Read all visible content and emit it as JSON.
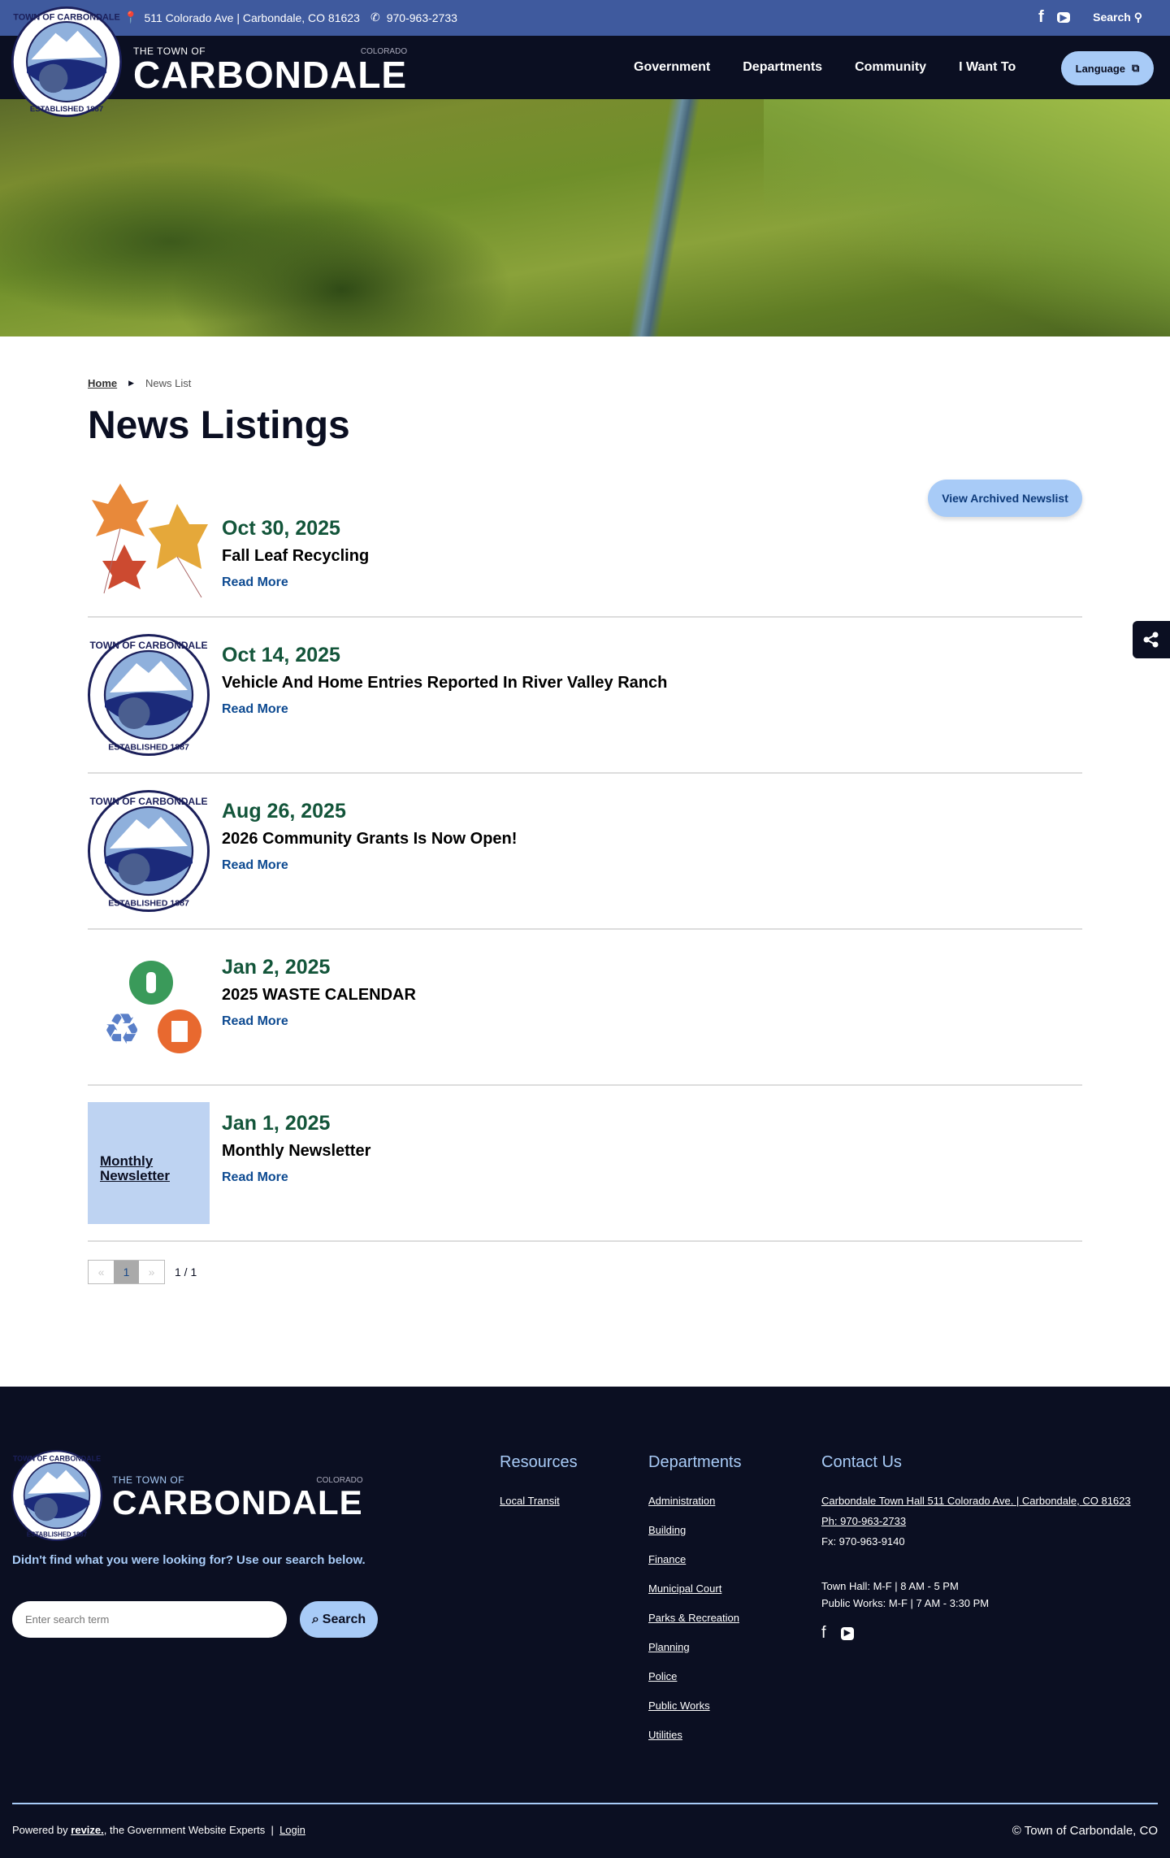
{
  "topbar": {
    "address": "511 Colorado Ave | Carbondale, CO 81623",
    "phone": "970-963-2733",
    "search_label": "Search"
  },
  "brand": {
    "pre": "THE TOWN OF",
    "name": "CARBONDALE",
    "state": "COLORADO"
  },
  "nav": {
    "items": [
      "Government",
      "Departments",
      "Community",
      "I Want To"
    ],
    "language": "Language"
  },
  "breadcrumb": {
    "home": "Home",
    "current": "News List"
  },
  "page_title": "News Listings",
  "archive_button": "View Archived Newslist",
  "news": [
    {
      "date": "Oct 30, 2025",
      "title": "Fall Leaf Recycling",
      "link": "Read More",
      "image": "leaves"
    },
    {
      "date": "Oct 14, 2025",
      "title": "Vehicle And Home Entries Reported In River Valley Ranch",
      "link": "Read More",
      "image": "seal"
    },
    {
      "date": "Aug 26, 2025",
      "title": "2026 Community Grants Is Now Open!",
      "link": "Read More",
      "image": "seal"
    },
    {
      "date": "Jan 2, 2025",
      "title": "2025 WASTE CALENDAR",
      "link": "Read More",
      "image": "waste"
    },
    {
      "date": "Jan 1, 2025",
      "title": "Monthly Newsletter",
      "link": "Read More",
      "image": "newsletter",
      "image_text": "Monthly Newsletter"
    }
  ],
  "pagination": {
    "prev": "«",
    "current": "1",
    "next": "»",
    "summary": "1 / 1"
  },
  "footer": {
    "search_prompt": "Didn't find what you were looking for? Use our search below.",
    "search_placeholder": "Enter search term",
    "search_button": "Search",
    "resources": {
      "heading": "Resources",
      "links": [
        "Local Transit"
      ]
    },
    "departments": {
      "heading": "Departments",
      "links": [
        "Administration",
        "Building",
        "Finance",
        "Municipal Court",
        "Parks & Recreation",
        "Planning",
        "Police",
        "Public Works",
        "Utilities"
      ]
    },
    "contact": {
      "heading": "Contact Us",
      "address": "Carbondale Town Hall 511 Colorado Ave. | Carbondale, CO 81623",
      "phone": "Ph: 970-963-2733",
      "fax": "Fx: 970-963-9140",
      "hours_town": "Town Hall: M-F | 8 AM - 5 PM",
      "hours_pw": "Public Works: M-F | 7 AM - 3:30 PM"
    },
    "powered_pre": "Powered by",
    "powered_brand": "revize.",
    "powered_post": ", the Government Website Experts",
    "login": "Login",
    "copyright": "© Town of Carbondale, CO"
  },
  "seal_text": "TOWN OF CARBONDALE ESTABLISHED 1887"
}
